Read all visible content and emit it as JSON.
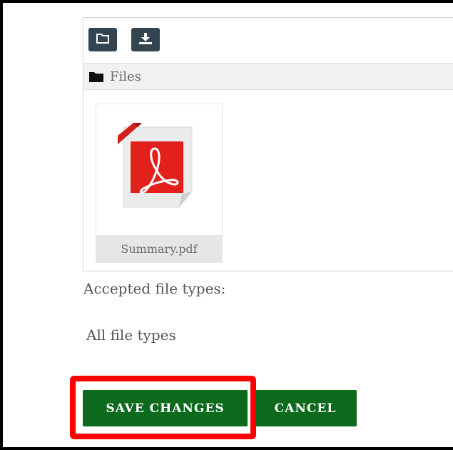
{
  "file_manager": {
    "toolbar": {
      "folder_button_icon": "folder-outline-icon",
      "download_button_icon": "download-icon"
    },
    "path": {
      "icon": "folder-icon",
      "label": "Files"
    },
    "files": [
      {
        "name": "Summary.pdf",
        "icon": "pdf-icon"
      }
    ]
  },
  "accepted_types": {
    "label": "Accepted file types:",
    "value": "All file types"
  },
  "actions": {
    "save_label": "SAVE CHANGES",
    "cancel_label": "CANCEL"
  },
  "colors": {
    "button_green": "#0b6a1c",
    "toolbar_button": "#344451",
    "highlight_red": "#ff0000",
    "pdf_red": "#e2211c"
  }
}
